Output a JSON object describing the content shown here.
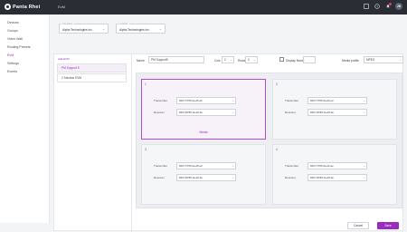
{
  "app": {
    "brand": "Panta Rhei",
    "section": "EvM",
    "avatar_initials": "JK"
  },
  "sidebar": {
    "items": [
      {
        "label": "Devices",
        "active": false
      },
      {
        "label": "Groups",
        "active": false
      },
      {
        "label": "Video Wall",
        "active": false
      },
      {
        "label": "Routing Presets",
        "active": false
      },
      {
        "label": "EvM",
        "active": true
      },
      {
        "label": "Settings",
        "active": false
      },
      {
        "label": "Events",
        "active": false
      }
    ]
  },
  "filters": {
    "company": {
      "label": "Company",
      "value": "Alpha Technologies Inc."
    },
    "location": {
      "label": "Location",
      "value": "Alpha Technologies Inc."
    }
  },
  "evm_list": {
    "add_label": "Add EVM",
    "items": [
      {
        "label": "PM Support 5",
        "active": true
      },
      {
        "label": "2 Solution EVM",
        "active": false
      }
    ]
  },
  "form": {
    "name_label": "Name",
    "name_value": "PM Support5",
    "cols_label": "Cols",
    "cols_value": "2",
    "rows_label": "Rows",
    "rows_value": "2",
    "display_label": "Display Name",
    "display_value": "",
    "media_label": "Media profile",
    "media_value": "MPEG"
  },
  "cells": [
    {
      "num": "1",
      "transmitter_label": "Transmitter",
      "transmitter_value": "RDX-TX56-0a-d6-ab",
      "receiver_label": "Receiver",
      "receiver_value": "RDX-RX56-0a-d6-6e",
      "media_link": "Media",
      "selected": true
    },
    {
      "num": "2",
      "transmitter_label": "Transmitter",
      "transmitter_value": "RDX-TX56-0a-d0-e2",
      "receiver_label": "Receiver",
      "receiver_value": "RDX-RX56-0a-d6-6e",
      "selected": false
    },
    {
      "num": "3",
      "transmitter_label": "Transmitter",
      "transmitter_value": "RDX-TX56-0a-d6-a3",
      "receiver_label": "Receiver",
      "receiver_value": "RDX-RX56-0a-d6-6e",
      "selected": false
    },
    {
      "num": "4",
      "transmitter_label": "Transmitter",
      "transmitter_value": "RDX-TX56-0a-d2-ae",
      "receiver_label": "Receiver",
      "receiver_value": "RDX-RX56-0a-d6-6e",
      "selected": false
    }
  ],
  "actions": {
    "cancel": "Cancel",
    "save": "Save"
  },
  "colors": {
    "accent": "#9b2bbf",
    "topbar": "#2a2d34"
  }
}
